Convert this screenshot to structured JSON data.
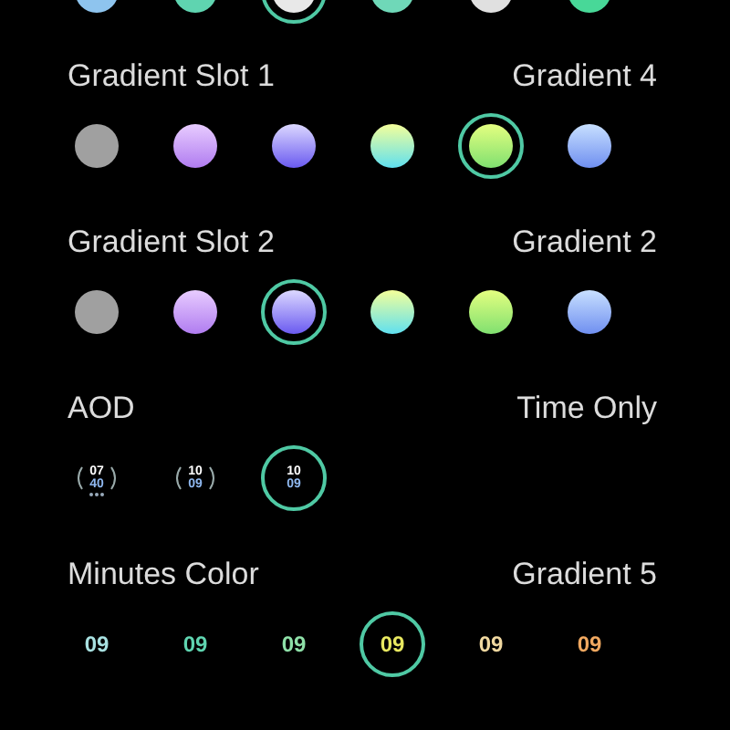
{
  "top_row": {
    "options": [
      {
        "selected": false
      },
      {
        "selected": false
      },
      {
        "selected": true
      },
      {
        "selected": false
      },
      {
        "selected": false
      },
      {
        "selected": false
      }
    ]
  },
  "sections": [
    {
      "title": "Gradient Slot 1",
      "value": "Gradient 4",
      "kind": "swatch",
      "options": [
        {
          "selected": false
        },
        {
          "selected": false
        },
        {
          "selected": false
        },
        {
          "selected": false
        },
        {
          "selected": true
        },
        {
          "selected": false
        }
      ]
    },
    {
      "title": "Gradient Slot 2",
      "value": "Gradient 2",
      "kind": "swatch",
      "options": [
        {
          "selected": false
        },
        {
          "selected": false
        },
        {
          "selected": true
        },
        {
          "selected": false
        },
        {
          "selected": false
        },
        {
          "selected": false
        }
      ]
    },
    {
      "title": "AOD",
      "value": "Time Only",
      "kind": "watch",
      "options": [
        {
          "hours": "07",
          "minutes": "40",
          "selected": false
        },
        {
          "hours": "10",
          "minutes": "09",
          "selected": false
        },
        {
          "hours": "10",
          "minutes": "09",
          "selected": true
        }
      ]
    },
    {
      "title": "Minutes Color",
      "value": "Gradient 5",
      "kind": "digits",
      "options": [
        {
          "text": "09",
          "color": "#a8e0e0",
          "selected": false
        },
        {
          "text": "09",
          "color": "#5fd4b0",
          "selected": false
        },
        {
          "text": "09",
          "color": "#8ee0a8",
          "selected": false
        },
        {
          "text": "09",
          "color": "#e8e860",
          "selected": true
        },
        {
          "text": "09",
          "color": "#f0d8a0",
          "selected": false
        },
        {
          "text": "09",
          "color": "#f0a860",
          "selected": false
        }
      ]
    }
  ]
}
